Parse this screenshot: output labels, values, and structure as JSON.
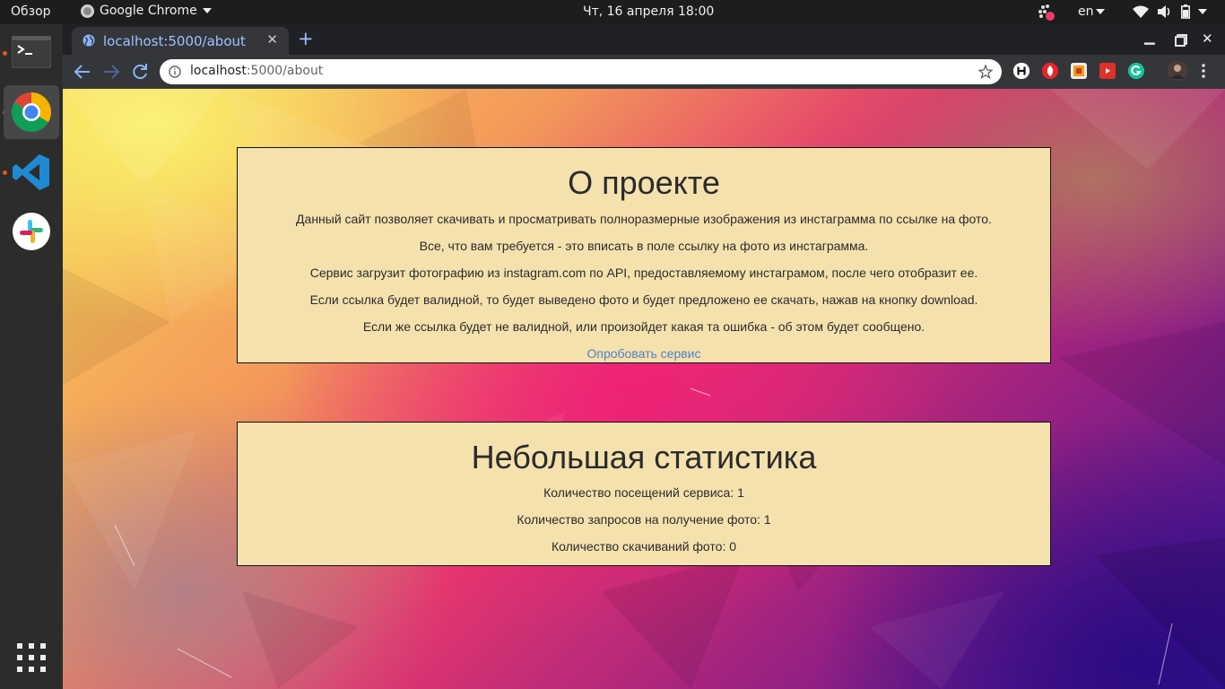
{
  "gnome": {
    "activities": "Обзор",
    "app_name": "Google Chrome",
    "clock": "Чт, 16 апреля  18:00",
    "keyboard_layout": "en"
  },
  "dock": {
    "items": [
      "terminal-icon",
      "chrome-icon",
      "vscode-icon",
      "slack-icon"
    ],
    "running": [
      "terminal",
      "chrome",
      "vscode"
    ],
    "active": "chrome"
  },
  "browser": {
    "tab_title": "localhost:5000/about",
    "url_host": "localhost",
    "url_path": ":5000/about",
    "accent": "#8ab4f8"
  },
  "about": {
    "title": "О проекте",
    "paragraphs": [
      "Данный сайт позволяет скачивать и просматривать полноразмерные изображения из инстаграмма по ссылке на фото.",
      "Все, что вам требуется - это вписать в поле ссылку на фото из инстаграмма.",
      "Сервис загрузит фотографию из instagram.com по API, предоставляемому инстаграмом, после чего отобразит ее.",
      "Если ссылка будет валидной, то будет выведено фото и будет предложено ее скачать, нажав на кнопку download.",
      "Если же ссылка будет не валидной, или произойдет какая та ошибка - об этом будет сообщено."
    ],
    "link_label": "Опробовать сервис"
  },
  "stats": {
    "title": "Небольшая статистика",
    "lines": [
      "Количество посещений сервиса: 1",
      "Количество запросов на получение фото: 1",
      "Количество скачиваний фото: 0"
    ]
  },
  "colors": {
    "card_bg": "#f5e1ae",
    "link": "#4f7fc4",
    "topbar": "#1d1d1d",
    "tabstrip": "#202124",
    "toolbar": "#35363a"
  }
}
